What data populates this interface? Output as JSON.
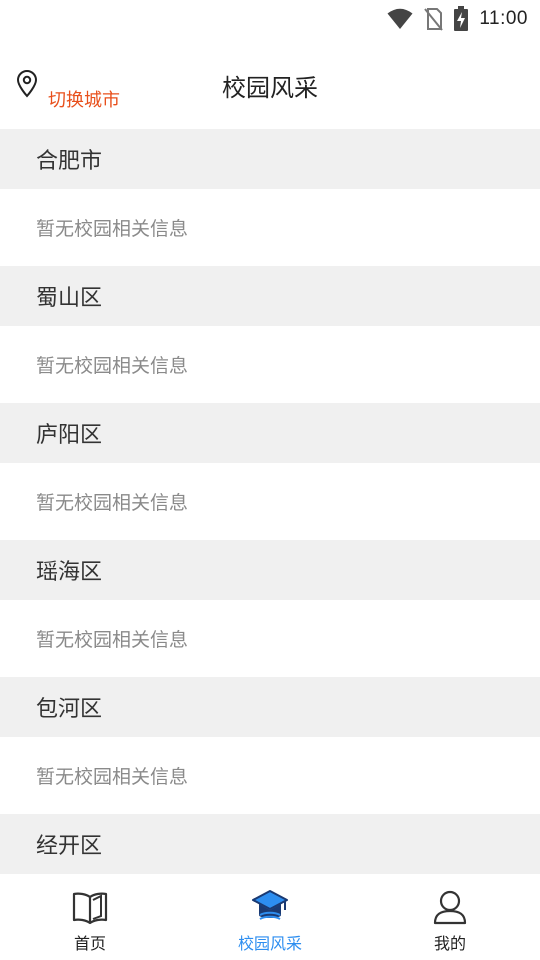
{
  "status_bar": {
    "time": "11:00"
  },
  "header": {
    "title": "校园风采",
    "switch_city_label": "切换城市",
    "accent_color": "#e8501c"
  },
  "districts": [
    {
      "name": "合肥市",
      "empty_text": "暂无校园相关信息"
    },
    {
      "name": "蜀山区",
      "empty_text": "暂无校园相关信息"
    },
    {
      "name": "庐阳区",
      "empty_text": "暂无校园相关信息"
    },
    {
      "name": "瑶海区",
      "empty_text": "暂无校园相关信息"
    },
    {
      "name": "包河区",
      "empty_text": "暂无校园相关信息"
    },
    {
      "name": "经开区",
      "empty_text": ""
    }
  ],
  "tabs": [
    {
      "label": "首页",
      "icon": "book-icon",
      "active": false
    },
    {
      "label": "校园风采",
      "icon": "graduation-cap-icon",
      "active": true
    },
    {
      "label": "我的",
      "icon": "user-icon",
      "active": false
    }
  ],
  "active_tab_color": "#2d8ef0"
}
